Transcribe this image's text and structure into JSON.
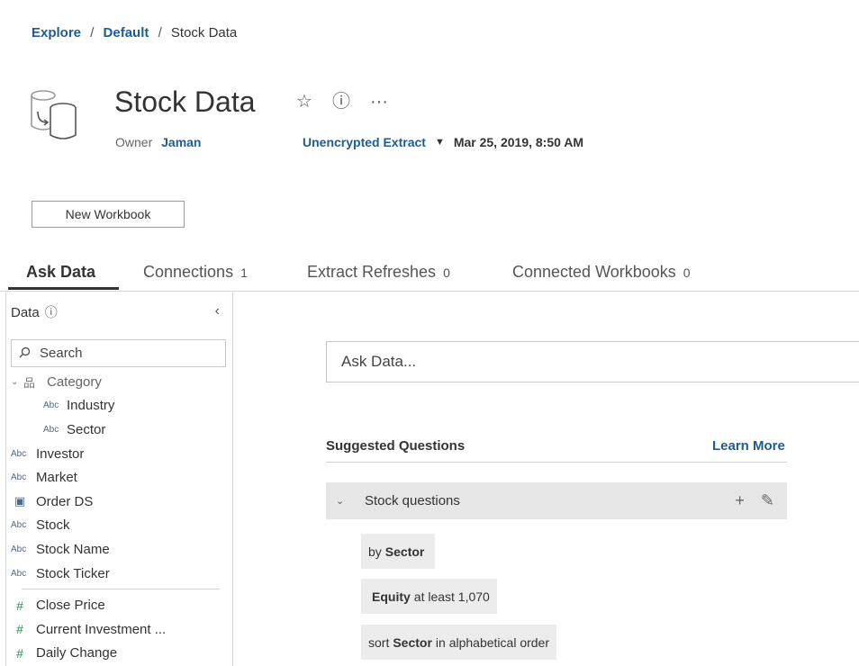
{
  "breadcrumb": {
    "items": [
      "Explore",
      "Default"
    ],
    "separator": "/",
    "current": "Stock Data"
  },
  "header": {
    "title": "Stock Data",
    "favorite_icon": "☆",
    "info_icon": "ⓘ",
    "more_icon": "···",
    "owner_label": "Owner",
    "owner_name": "Jaman",
    "extract_type": "Unencrypted Extract",
    "extract_caret": "▼",
    "date": "Mar 25, 2019, 8:50 AM"
  },
  "actions": {
    "new_workbook": "New Workbook"
  },
  "tabs": [
    {
      "label": "Ask Data",
      "count": "",
      "active": true
    },
    {
      "label": "Connections",
      "count": "1"
    },
    {
      "label": "Extract Refreshes",
      "count": "0"
    },
    {
      "label": "Connected Workbooks",
      "count": "0"
    }
  ],
  "sidebar": {
    "title": "Data",
    "info_icon": "ⓘ",
    "collapse_icon": "‹",
    "search_placeholder": "Search",
    "search_icon": "⌕",
    "group": {
      "chevron": "⌄",
      "icon": "品",
      "label": "Category"
    },
    "type_abc": "Abc",
    "type_date": "▣",
    "type_num": "#",
    "fields": [
      {
        "label": "Industry",
        "type": "Abc"
      },
      {
        "label": "Sector",
        "type": "Abc"
      },
      {
        "label": "Investor",
        "type": "Abc"
      },
      {
        "label": "Market",
        "type": "Abc"
      },
      {
        "label": "Order DS",
        "type": "date"
      },
      {
        "label": "Stock",
        "type": "Abc"
      },
      {
        "label": "Stock Name",
        "type": "Abc"
      },
      {
        "label": "Stock Ticker",
        "type": "Abc"
      }
    ],
    "measures": [
      {
        "label": "Close Price"
      },
      {
        "label": "Current Investment ..."
      },
      {
        "label": "Daily Change"
      }
    ]
  },
  "ask": {
    "placeholder": "Ask Data..."
  },
  "suggested": {
    "title": "Suggested Questions",
    "learn_more": "Learn More",
    "group_chevron": "⌄",
    "group_label": "Stock questions",
    "add_icon": "+",
    "edit_icon": "✎",
    "questions": [
      {
        "pre": "by",
        "bold": "Sector",
        "post": ""
      },
      {
        "pre": "",
        "bold": "Equity",
        "post": "at least 1,070"
      },
      {
        "pre": "sort",
        "bold": "Sector",
        "post": "in alphabetical order"
      }
    ]
  }
}
